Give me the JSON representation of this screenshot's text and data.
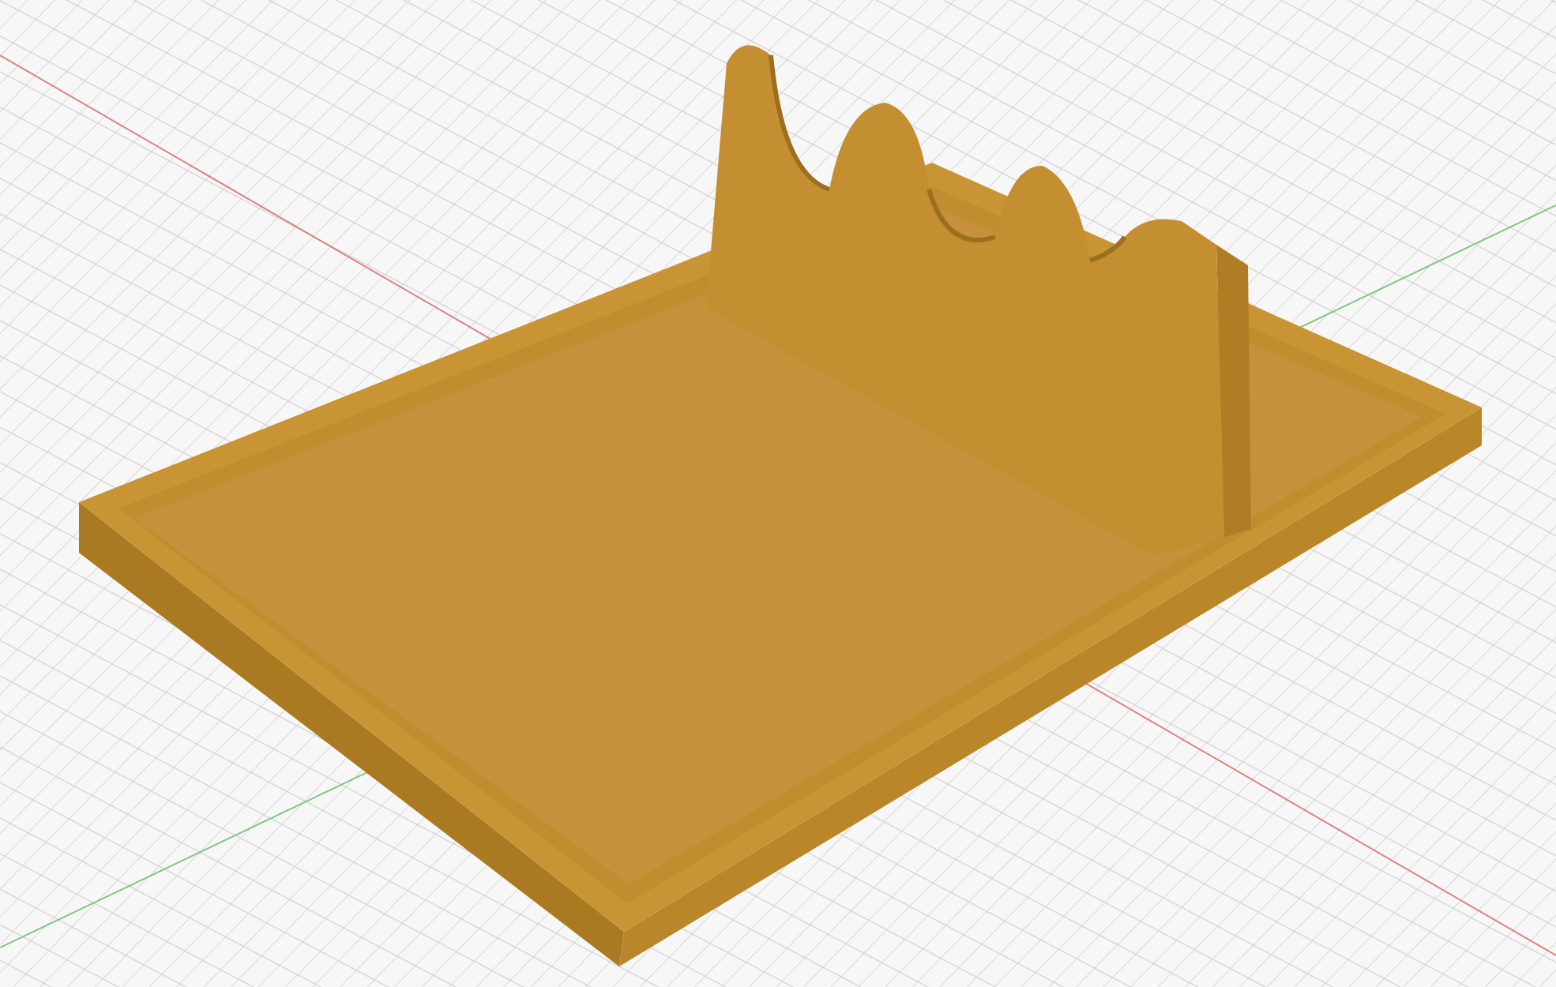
{
  "viewport": {
    "model": {
      "kind": "tray-with-stand"
    }
  }
}
